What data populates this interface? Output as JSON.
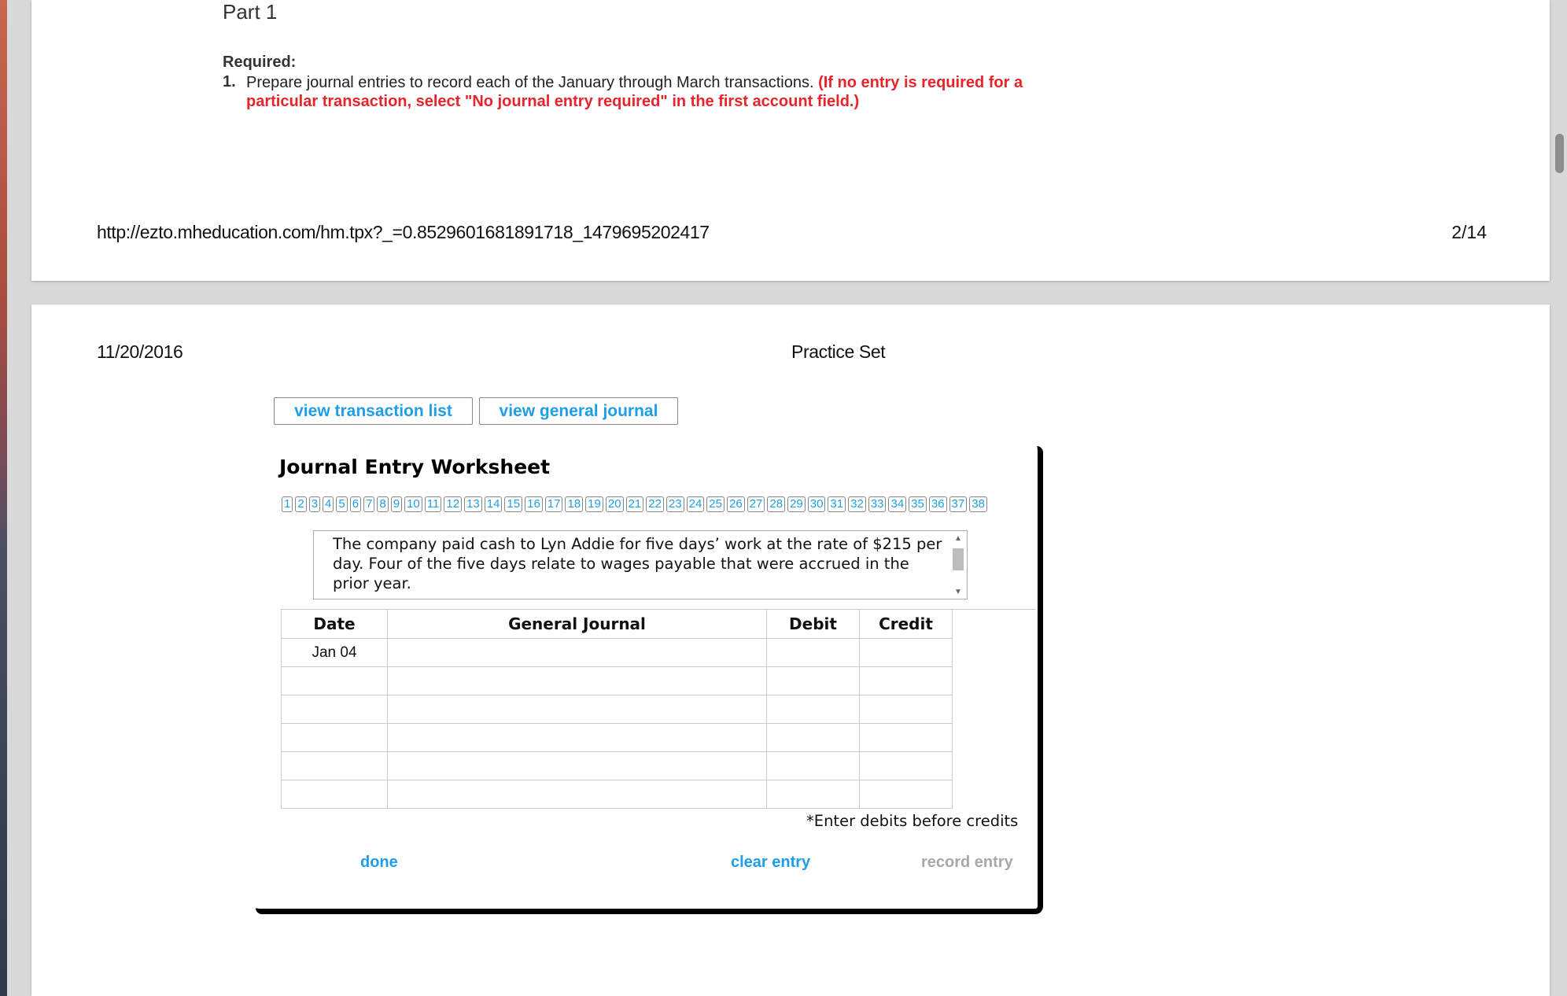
{
  "page1": {
    "part_title": "Part 1",
    "required_label": "Required:",
    "item_number": "1.",
    "instruction": "Prepare journal entries to record each of the January through March transactions. ",
    "instruction_note": "(If no entry is required for a particular transaction, select \"No journal entry required\" in the first account field.)",
    "footer_url": "http://ezto.mheducation.com/hm.tpx?_=0.8529601681891718_1479695202417",
    "footer_page": "2/14"
  },
  "page2": {
    "header_date": "11/20/2016",
    "header_title": "Practice Set",
    "btn_view_transactions": "view transaction list",
    "btn_view_journal": "view general journal"
  },
  "worksheet": {
    "title": "Journal Entry Worksheet",
    "transaction_numbers": [
      "1",
      "2",
      "3",
      "4",
      "5",
      "6",
      "7",
      "8",
      "9",
      "10",
      "11",
      "12",
      "13",
      "14",
      "15",
      "16",
      "17",
      "18",
      "19",
      "20",
      "21",
      "22",
      "23",
      "24",
      "25",
      "26",
      "27",
      "28",
      "29",
      "30",
      "31",
      "32",
      "33",
      "34",
      "35",
      "36",
      "37",
      "38"
    ],
    "description": "The company paid cash to Lyn Addie for five days’ work at the rate of $215 per day. Four of the five days relate to wages payable that were accrued in the prior year.",
    "columns": {
      "date": "Date",
      "general_journal": "General Journal",
      "debit": "Debit",
      "credit": "Credit"
    },
    "rows": [
      {
        "date": "Jan 04",
        "account": "",
        "debit": "",
        "credit": ""
      },
      {
        "date": "",
        "account": "",
        "debit": "",
        "credit": ""
      },
      {
        "date": "",
        "account": "",
        "debit": "",
        "credit": ""
      },
      {
        "date": "",
        "account": "",
        "debit": "",
        "credit": ""
      },
      {
        "date": "",
        "account": "",
        "debit": "",
        "credit": ""
      },
      {
        "date": "",
        "account": "",
        "debit": "",
        "credit": ""
      }
    ],
    "hint": "*Enter debits before credits",
    "actions": {
      "done": "done",
      "clear": "clear entry",
      "record": "record entry"
    }
  },
  "colors": {
    "link_blue": "#1e9ee8",
    "note_red": "#e8242a",
    "disabled_gray": "#a8a8a8"
  }
}
